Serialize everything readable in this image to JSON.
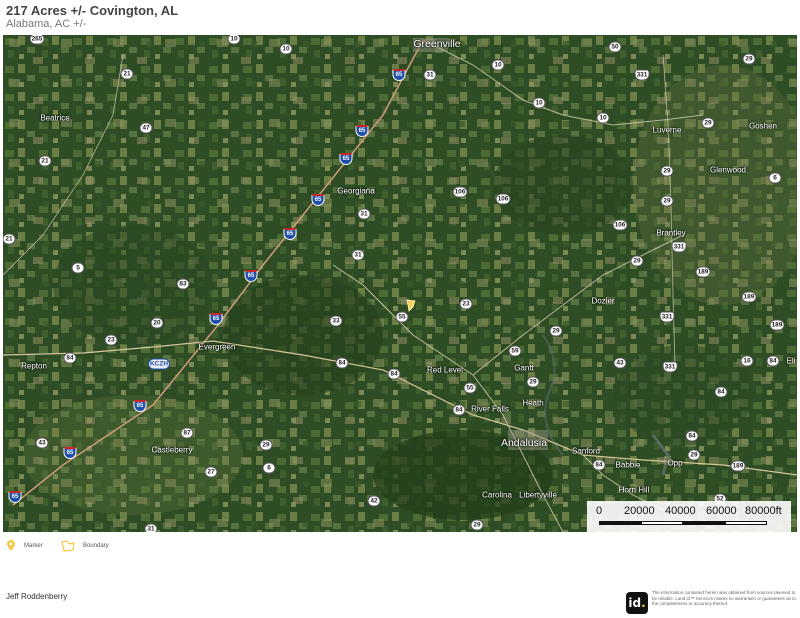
{
  "header": {
    "title": "217 Acres +/- Covington, AL",
    "subtitle": "Alabama,  AC +/-"
  },
  "map": {
    "cities": [
      {
        "name": "Greenville",
        "major": true
      },
      {
        "name": "Beatrice",
        "major": false
      },
      {
        "name": "Luverne",
        "major": false
      },
      {
        "name": "Goshen",
        "major": false
      },
      {
        "name": "Georgiana",
        "major": false
      },
      {
        "name": "Glenwood",
        "major": false
      },
      {
        "name": "Brantley",
        "major": false
      },
      {
        "name": "Dozier",
        "major": false
      },
      {
        "name": "Repton",
        "major": false
      },
      {
        "name": "Evergreen",
        "major": false
      },
      {
        "name": "Red Level",
        "major": false
      },
      {
        "name": "Gantt",
        "major": false
      },
      {
        "name": "River Falls",
        "major": false
      },
      {
        "name": "Heath",
        "major": false
      },
      {
        "name": "Andalusia",
        "major": true
      },
      {
        "name": "Sanford",
        "major": false
      },
      {
        "name": "Babbie",
        "major": false
      },
      {
        "name": "Opp",
        "major": false
      },
      {
        "name": "Castleberry",
        "major": false
      },
      {
        "name": "Horn Hill",
        "major": false
      },
      {
        "name": "Carolina",
        "major": false
      },
      {
        "name": "Libertyville",
        "major": false
      },
      {
        "name": "Eli",
        "major": false
      }
    ],
    "shields": [
      "265",
      "10",
      "10",
      "50",
      "331",
      "29",
      "21",
      "31",
      "10",
      "10",
      "65",
      "47",
      "29",
      "65",
      "10",
      "21",
      "65",
      "29",
      "6",
      "106",
      "106",
      "65",
      "31",
      "106",
      "29",
      "21",
      "31",
      "65",
      "331",
      "189",
      "5",
      "65",
      "189",
      "83",
      "23",
      "29",
      "331",
      "33",
      "55",
      "189",
      "20",
      "65",
      "23",
      "KCZH",
      "59",
      "29",
      "84",
      "84",
      "84",
      "43",
      "331",
      "84",
      "16",
      "55",
      "29",
      "84",
      "65",
      "43",
      "84",
      "87",
      "29",
      "84",
      "29",
      "27",
      "6",
      "84",
      "65",
      "42",
      "52",
      "31",
      "29",
      "189"
    ],
    "marker": {
      "name": "subject-property-marker"
    },
    "scale_bar": {
      "labels": [
        "0",
        "20000",
        "40000",
        "60000",
        "80000ft"
      ]
    }
  },
  "legend": {
    "marker_label": "Marker",
    "boundary_label": "Boundary",
    "marker_color": "#f4c842",
    "boundary_color": "#f4c842"
  },
  "footer": {
    "agent_name": "Jeff Roddenberry",
    "logo_text": "id",
    "disclaimer": "The information contained herein was obtained from sources deemed to be reliable. Land id™ Services makes no warranties or guarantees as to the completeness or accuracy thereof."
  }
}
